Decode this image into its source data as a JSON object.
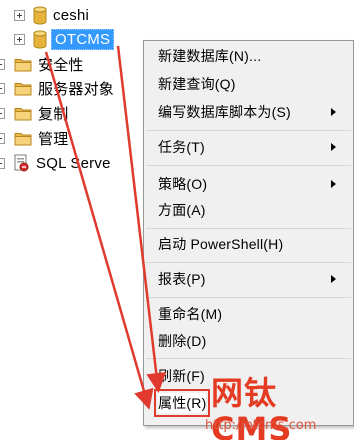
{
  "tree": {
    "items": [
      {
        "label": "ceshi"
      },
      {
        "label": "OTCMS"
      },
      {
        "label": "安全性"
      },
      {
        "label": "服务器对象"
      },
      {
        "label": "复制"
      },
      {
        "label": "管理"
      },
      {
        "label": "SQL Serve"
      }
    ]
  },
  "menu": {
    "items": [
      {
        "label": "新建数据库(N)..."
      },
      {
        "label": "新建查询(Q)"
      },
      {
        "label": "编写数据库脚本为(S)"
      },
      {
        "label": "任务(T)"
      },
      {
        "label": "策略(O)"
      },
      {
        "label": "方面(A)"
      },
      {
        "label": "启动 PowerShell(H)"
      },
      {
        "label": "报表(P)"
      },
      {
        "label": "重命名(M)"
      },
      {
        "label": "删除(D)"
      },
      {
        "label": "刷新(F)"
      },
      {
        "label": "属性(R)"
      }
    ]
  },
  "watermark": {
    "logo": "网钛CMS",
    "url": "http://otcms.com"
  },
  "colors": {
    "selection": "#3399ff",
    "arrow": "#e03a2e",
    "watermark": "#e43b22",
    "folder": "#e8b84a",
    "database": "#e6b23c"
  }
}
